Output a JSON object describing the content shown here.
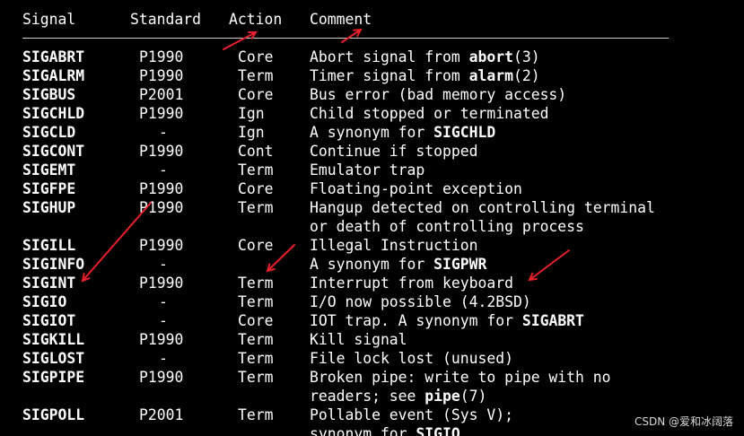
{
  "header": {
    "signal": "Signal",
    "standard": "Standard",
    "action": "Action",
    "comment": "Comment"
  },
  "rows": [
    {
      "signal": "SIGABRT",
      "standard": "P1990",
      "action": "Core",
      "comment_pre": "Abort signal from ",
      "comment_bold": "abort",
      "comment_post": "(3)"
    },
    {
      "signal": "SIGALRM",
      "standard": "P1990",
      "action": "Term",
      "comment_pre": "Timer signal from ",
      "comment_bold": "alarm",
      "comment_post": "(2)"
    },
    {
      "signal": "SIGBUS",
      "standard": "P2001",
      "action": "Core",
      "comment_pre": "Bus error (bad memory access)",
      "comment_bold": "",
      "comment_post": ""
    },
    {
      "signal": "SIGCHLD",
      "standard": "P1990",
      "action": "Ign",
      "comment_pre": "Child stopped or terminated",
      "comment_bold": "",
      "comment_post": ""
    },
    {
      "signal": "SIGCLD",
      "standard": "-",
      "action": "Ign",
      "comment_pre": "A synonym for ",
      "comment_bold": "SIGCHLD",
      "comment_post": ""
    },
    {
      "signal": "SIGCONT",
      "standard": "P1990",
      "action": "Cont",
      "comment_pre": "Continue if stopped",
      "comment_bold": "",
      "comment_post": ""
    },
    {
      "signal": "SIGEMT",
      "standard": "-",
      "action": "Term",
      "comment_pre": "Emulator trap",
      "comment_bold": "",
      "comment_post": ""
    },
    {
      "signal": "SIGFPE",
      "standard": "P1990",
      "action": "Core",
      "comment_pre": "Floating-point exception",
      "comment_bold": "",
      "comment_post": ""
    },
    {
      "signal": "SIGHUP",
      "standard": "P1990",
      "action": "Term",
      "comment_pre": "Hangup detected on controlling terminal",
      "comment_bold": "",
      "comment_post": ""
    },
    {
      "signal": "",
      "standard": "",
      "action": "",
      "comment_pre": "or death of controlling process",
      "comment_bold": "",
      "comment_post": ""
    },
    {
      "signal": "SIGILL",
      "standard": "P1990",
      "action": "Core",
      "comment_pre": "Illegal Instruction",
      "comment_bold": "",
      "comment_post": ""
    },
    {
      "signal": "SIGINFO",
      "standard": "-",
      "action": "",
      "comment_pre": "A synonym for ",
      "comment_bold": "SIGPWR",
      "comment_post": ""
    },
    {
      "signal": "SIGINT",
      "standard": "P1990",
      "action": "Term",
      "comment_pre": "Interrupt from keyboard",
      "comment_bold": "",
      "comment_post": ""
    },
    {
      "signal": "SIGIO",
      "standard": "-",
      "action": "Term",
      "comment_pre": "I/O now possible (4.2BSD)",
      "comment_bold": "",
      "comment_post": ""
    },
    {
      "signal": "SIGIOT",
      "standard": "-",
      "action": "Core",
      "comment_pre": "IOT trap. A synonym for ",
      "comment_bold": "SIGABRT",
      "comment_post": ""
    },
    {
      "signal": "SIGKILL",
      "standard": "P1990",
      "action": "Term",
      "comment_pre": "Kill signal",
      "comment_bold": "",
      "comment_post": ""
    },
    {
      "signal": "SIGLOST",
      "standard": "-",
      "action": "Term",
      "comment_pre": "File lock lost (unused)",
      "comment_bold": "",
      "comment_post": ""
    },
    {
      "signal": "SIGPIPE",
      "standard": "P1990",
      "action": "Term",
      "comment_pre": "Broken pipe: write to pipe with no",
      "comment_bold": "",
      "comment_post": ""
    },
    {
      "signal": "",
      "standard": "",
      "action": "",
      "comment_pre": "readers; see ",
      "comment_bold": "pipe",
      "comment_post": "(7)"
    },
    {
      "signal": "SIGPOLL",
      "standard": "P2001",
      "action": "Term",
      "comment_pre": "Pollable event (Sys V);",
      "comment_bold": "",
      "comment_post": ""
    },
    {
      "signal": "",
      "standard": "",
      "action": "",
      "comment_pre": "synonym for ",
      "comment_bold": "SIGIO",
      "comment_post": ""
    }
  ],
  "annotation_color": "#e8202a",
  "watermark": "CSDN @爱和冰阔落"
}
